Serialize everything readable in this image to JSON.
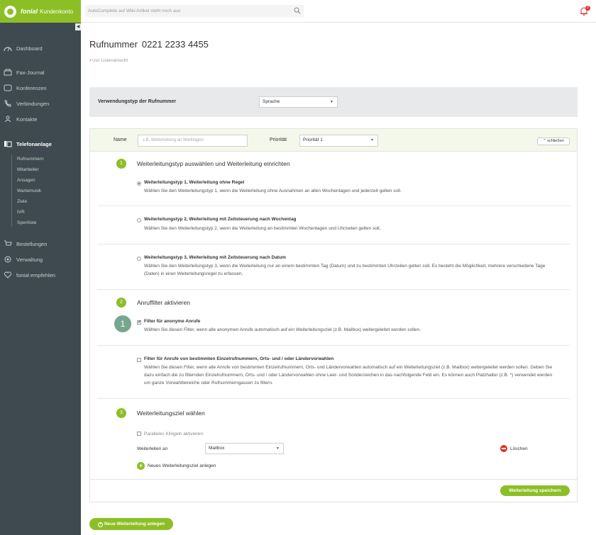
{
  "app": {
    "brand": "fonial",
    "brand_sub": "Kundenkonto",
    "colors": {
      "accent": "#8cbf26",
      "sidebar": "#3e4a4f",
      "danger": "#e0322d"
    }
  },
  "topbar": {
    "search_placeholder": "AutoComplete auf Wiki-Artikel steht noch aus",
    "notification_count": "2"
  },
  "sidebar": {
    "items": [
      {
        "label": "Dashboard",
        "icon": "dashboard-icon"
      },
      {
        "label": "Fax-Journal",
        "icon": "fax-icon"
      },
      {
        "label": "Konferenzen",
        "icon": "conference-icon"
      },
      {
        "label": "Verbindungen",
        "icon": "phone-icon"
      },
      {
        "label": "Kontakte",
        "icon": "contacts-icon"
      },
      {
        "label": "Telefonanlage",
        "icon": "phone-system-icon"
      },
      {
        "label": "Bestellungen",
        "icon": "cart-icon"
      },
      {
        "label": "Verwaltung",
        "icon": "settings-icon"
      },
      {
        "label": "fonial empfehlen",
        "icon": "recommend-icon"
      }
    ],
    "subitems": [
      "Rufnummern",
      "Mitarbeiter",
      "Ansagen",
      "Wartemusik",
      "Ziele",
      "IVR",
      "Sperrliste"
    ]
  },
  "page": {
    "title": "Rufnummer",
    "number": "0221 2233 4455",
    "back_link": "zur Listenansicht",
    "usage_label": "Verwendungstyp der Rufnummer",
    "usage_value": "Sprache"
  },
  "rule": {
    "name_label": "Name",
    "name_placeholder": "z.B. Weiterleitung an Werktagen",
    "priority_label": "Priorität",
    "priority_value": "Priorität 1",
    "close_label": "schließen",
    "step1": {
      "num": "1",
      "title": "Weiterleitungstyp auswählen und Weiterleitung einrichten",
      "options": [
        {
          "title": "Weiterleitungstyp 1, Weiterleitung ohne Regel",
          "desc": "Wählen Sie den Weiterleitungstyp 1, wenn die Weiterleitung ohne Ausnahmen an allen Wochentagen und jederzeit gelten soll."
        },
        {
          "title": "Weiterleitungstyp 2, Weiterleitung mit Zeitsteuerung nach Wochentag",
          "desc": "Wählen Sie den Weiterleitungstyp 2, wenn die Weiterleitung an bestimmten Wochentagen und Uhrzeiten gelten soll."
        },
        {
          "title": "Weiterleitungstyp 3, Weiterleitung mit Zeitsteuerung nach Datum",
          "desc": "Wählen Sie den Weiterleitungstyp 3, wenn die Weiterleitung nur an einem bestimmten Tag (Datum) und zu bestimmten Uhrzeiten gelten soll. Es besteht die Möglichkeit, mehrere verschiedene Tage (Daten) in einer Weiterleitungsregel zu erfassen."
        }
      ]
    },
    "step2": {
      "num": "2",
      "title": "Anruffilter aktivieren",
      "badge": "1",
      "options": [
        {
          "title": "Filter für anonyme Anrufe",
          "desc": "Wählen Sie diesen Filter, wenn alle anonymen Anrufe automatisch auf ein Weiterleitungsziel (z.B. Mailbox) weitergeleitet werden sollen."
        },
        {
          "title": "Filter für Anrufe von bestimmten Einzelrufnummern, Orts- und / oder Ländervorwahlen",
          "desc": "Wählen Sie diesen Filter, wenn alle Anrufe von bestimmten Einzelrufnummern, Orts- und Ländervorwahlen automatisch auf ein Weiterleitungsziel (z.B. Mailbox) weitergeleitet werden sollen. Geben Sie dazu einfach die zu filternden Einzelrufnummern, Orts- und / oder Ländervorwahlen ohne Leer- und Sonderzeichen in das nachfolgende Feld ein. Es können auch Platzhalter (z.B. *) verwendet werden um ganze Vorwahlbereiche oder Rufnummerngassen zu filtern."
        }
      ]
    },
    "step3": {
      "num": "3",
      "title": "Weiterleitungsziel wählen",
      "parallel_label": "Paralleles Klingeln aktivieren",
      "forward_label": "Weiterleiten an",
      "forward_value": "Mailbox",
      "delete_label": "Löschen",
      "add_label": "Neues Weiterleitungsziel anlegen"
    },
    "save_label": "Weiterleitung speichern"
  },
  "new_rule_label": "Neue Weiterleitung anlegen"
}
